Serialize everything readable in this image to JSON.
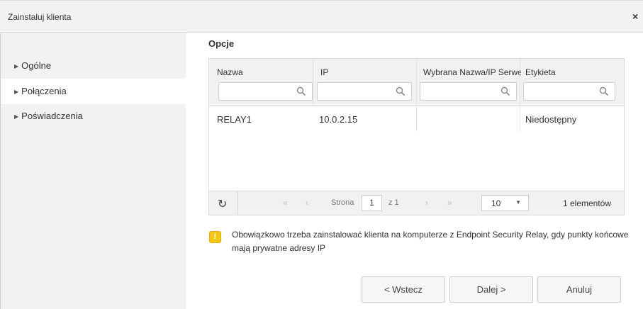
{
  "dialog": {
    "title": "Zainstaluj klienta",
    "close_glyph": "×"
  },
  "sidebar": {
    "items": [
      {
        "label": "Ogólne",
        "active": false
      },
      {
        "label": "Połączenia",
        "active": true
      },
      {
        "label": "Poświadczenia",
        "active": false
      }
    ]
  },
  "section": {
    "title": "Opcje"
  },
  "grid": {
    "columns": [
      "Nazwa",
      "IP",
      "Wybrana Nazwa/IP Serwera",
      "Etykieta"
    ],
    "filters": [
      "",
      "",
      "",
      ""
    ],
    "rows": [
      [
        "RELAY1",
        "10.0.2.15",
        "",
        "Niedostępny"
      ]
    ],
    "pager": {
      "first": "«",
      "prev": "‹",
      "page_label": "Strona",
      "page": "1",
      "of_label": "z 1",
      "next": "›",
      "last": "»",
      "page_size": "10",
      "count": "1 elementów",
      "refresh_glyph": "↻"
    }
  },
  "warning": {
    "text": "Obowiązkowo trzeba zainstalować klienta na komputerze z Endpoint Security Relay, gdy punkty końcowe mają prywatne adresy IP",
    "icon_glyph": "!",
    "color": "#f3c516"
  },
  "buttons": {
    "back": "< Wstecz",
    "next": "Dalej >",
    "cancel": "Anuluj"
  }
}
